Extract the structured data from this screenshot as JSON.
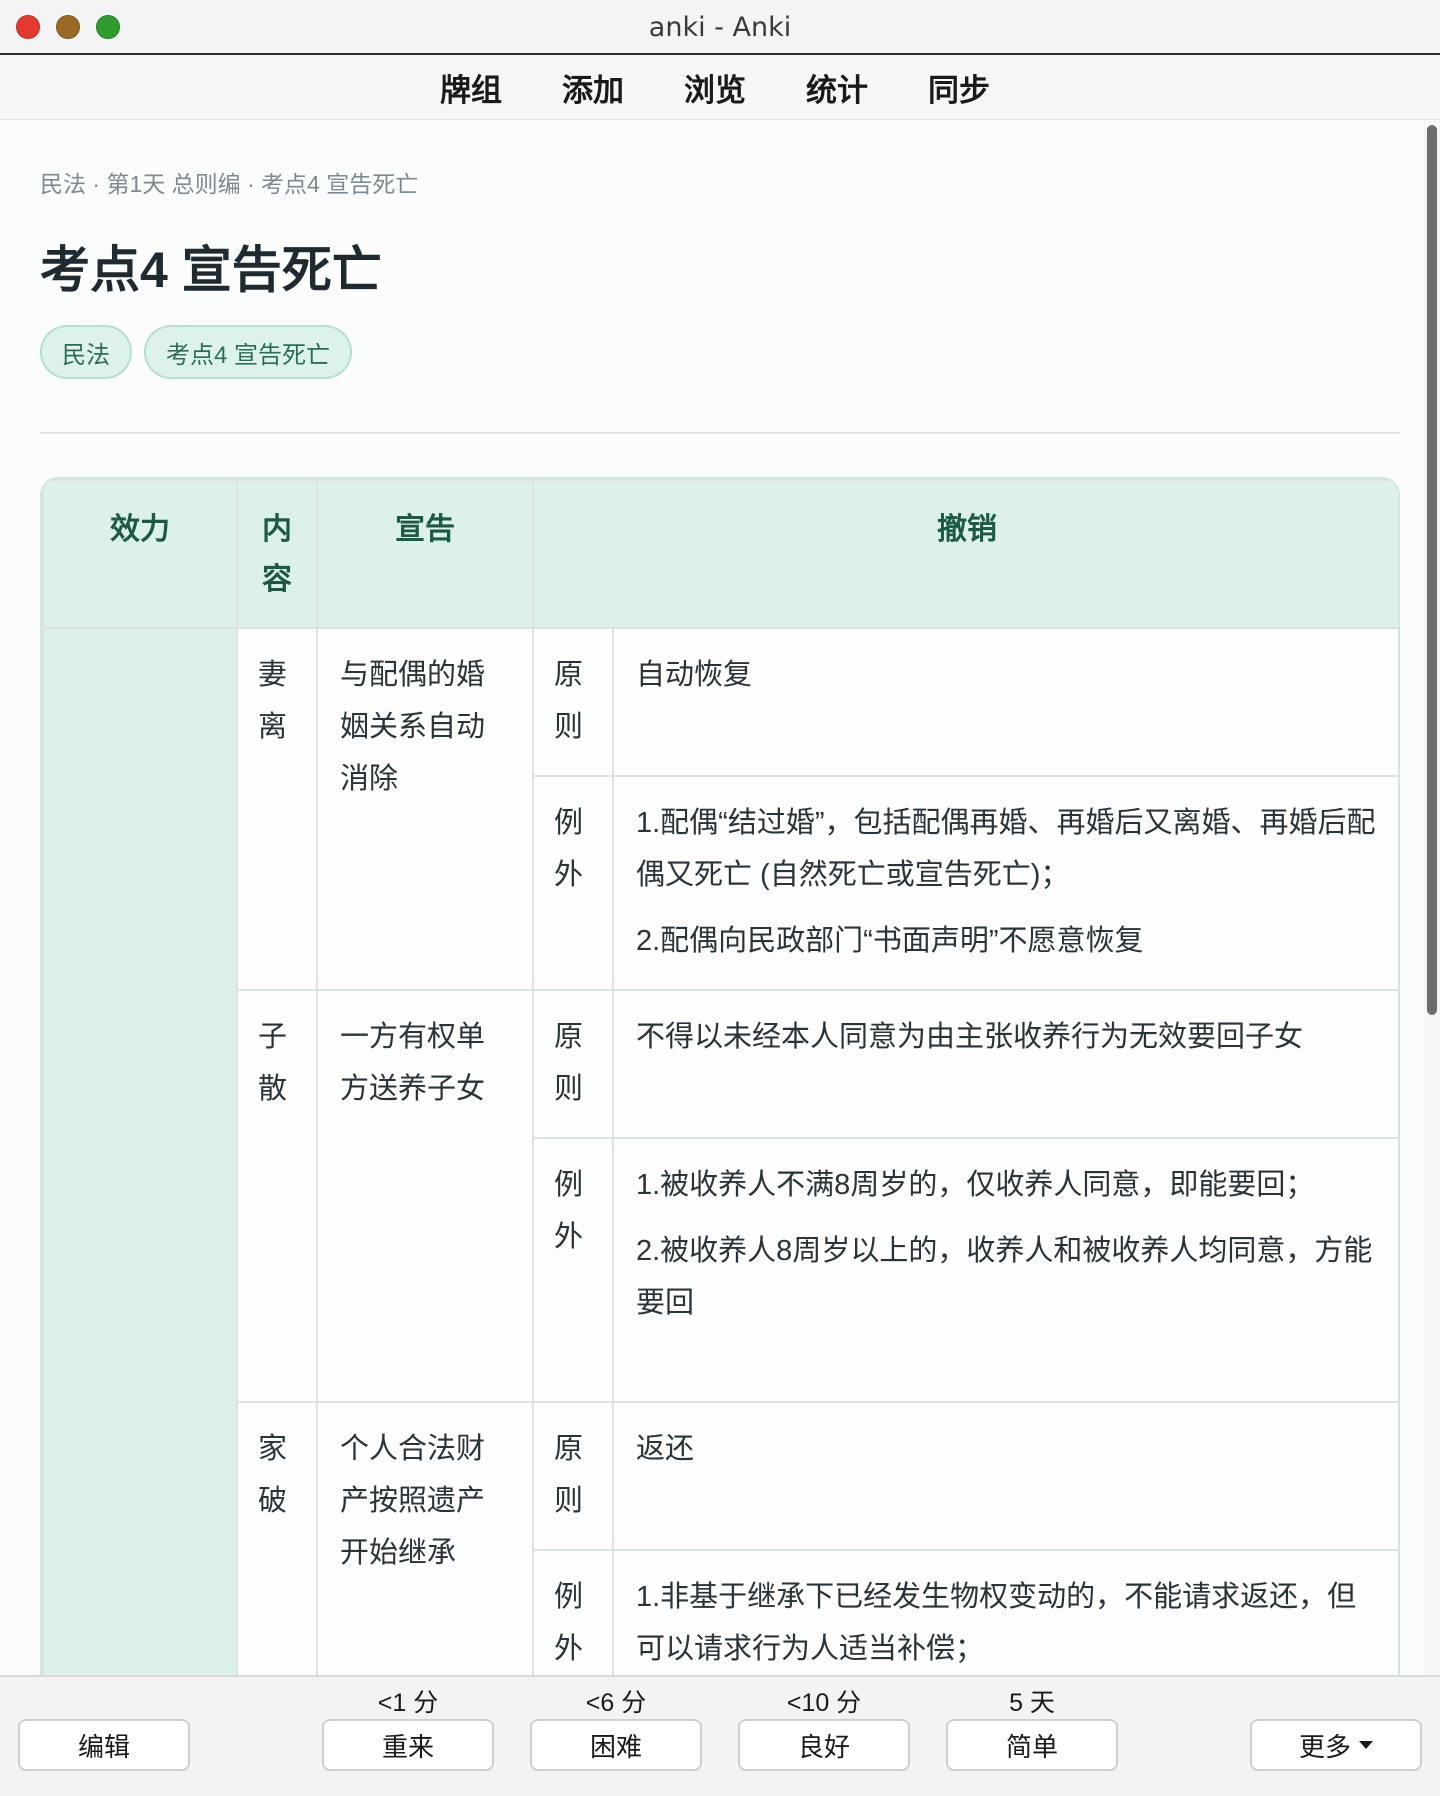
{
  "window": {
    "title": "anki - Anki"
  },
  "toolbar": {
    "items": [
      "牌组",
      "添加",
      "浏览",
      "统计",
      "同步"
    ]
  },
  "card": {
    "breadcrumb": "民法 · 第1天 总则编 · 考点4 宣告死亡",
    "title": "考点4 宣告死亡",
    "tags": [
      "民法",
      "考点4 宣告死亡"
    ],
    "table": {
      "headers": {
        "effect": "效力",
        "content": "内容",
        "declare": "宣告",
        "revoke": "撤销"
      },
      "rows": [
        {
          "category": "妻离",
          "declare": "与配偶的婚姻关系自动消除",
          "principle_label": "原则",
          "principle": "自动恢复",
          "exception_label": "例外",
          "exceptions": [
            "1.配偶“结过婚”，包括配偶再婚、再婚后又离婚、再婚后配偶又死亡 (自然死亡或宣告死亡)；",
            "2.配偶向民政部门“书面声明”不愿意恢复"
          ]
        },
        {
          "category": "子散",
          "declare": "一方有权单方送养子女",
          "principle_label": "原则",
          "principle": "不得以未经本人同意为由主张收养行为无效要回子女",
          "exception_label": "例外",
          "exceptions": [
            "1.被收养人不满8周岁的，仅收养人同意，即能要回；",
            "2.被收养人8周岁以上的，收养人和被收养人均同意，方能要回"
          ]
        },
        {
          "category": "家破",
          "declare": "个人合法财产按照遗产开始继承",
          "principle_label": "原则",
          "principle": "返还",
          "exception_label": "例外",
          "exceptions": [
            "1.非基于继承下已经发生物权变动的，不能请求返还，但可以请求行为人适当补偿；"
          ]
        }
      ]
    }
  },
  "answer_bar": {
    "edit": "编辑",
    "more": "更多",
    "buttons": [
      {
        "label": "重来",
        "interval": "<1 分"
      },
      {
        "label": "困难",
        "interval": "<6 分"
      },
      {
        "label": "良好",
        "interval": "<10 分"
      },
      {
        "label": "简单",
        "interval": "5 天"
      }
    ]
  }
}
